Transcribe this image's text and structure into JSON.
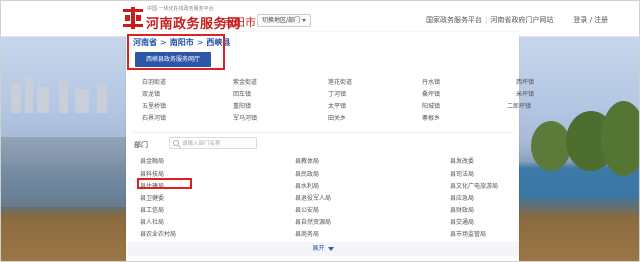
{
  "header": {
    "logo_sub": "中国·一体化在线政务服务平台",
    "logo_text": "河南政务服务网",
    "city": "南阳市",
    "switch_label": "切换地区/部门",
    "links": [
      "国家政务服务平台",
      "河南省政府门户网站",
      "登录 / 注册"
    ]
  },
  "breadcrumb": [
    "河南省",
    "南阳市",
    "西峡县"
  ],
  "hall_button": "西峡县政务服务网厅",
  "towns": [
    [
      "白羽街道",
      "紫金街道",
      "莲花街道",
      "丹水镇",
      "西坪镇"
    ],
    [
      "双龙镇",
      "回车镇",
      "丁河镇",
      "桑坪镇",
      "米坪镇"
    ],
    [
      "五里桥镇",
      "重阳镇",
      "太平镇",
      "阳城镇",
      "二郎坪镇"
    ],
    [
      "石界河镇",
      "军马河镇",
      "田关乡",
      "寨根乡",
      ""
    ]
  ],
  "department_label": "部门",
  "search_placeholder": "请输入部门名称",
  "departments": [
    [
      "县金融局",
      "县教体局",
      "县发改委"
    ],
    [
      "县科技局",
      "县民政局",
      "县司法局"
    ],
    [
      "县住建局",
      "县水利局",
      "县文化广电旅游局"
    ],
    [
      "县卫健委",
      "县退役军人局",
      "县应急局"
    ],
    [
      "县工信局",
      "县公安局",
      "县财政局"
    ],
    [
      "县人社局",
      "县自然资源局",
      "县交通局"
    ],
    [
      "县农业农村局",
      "县商务局",
      "县市场监管局"
    ]
  ],
  "expand_label": "展开",
  "colors": {
    "brand_red": "#c81d1d",
    "link_blue": "#1b4fa8",
    "button_blue": "#2d56a8",
    "highlight_red": "#e02020"
  }
}
